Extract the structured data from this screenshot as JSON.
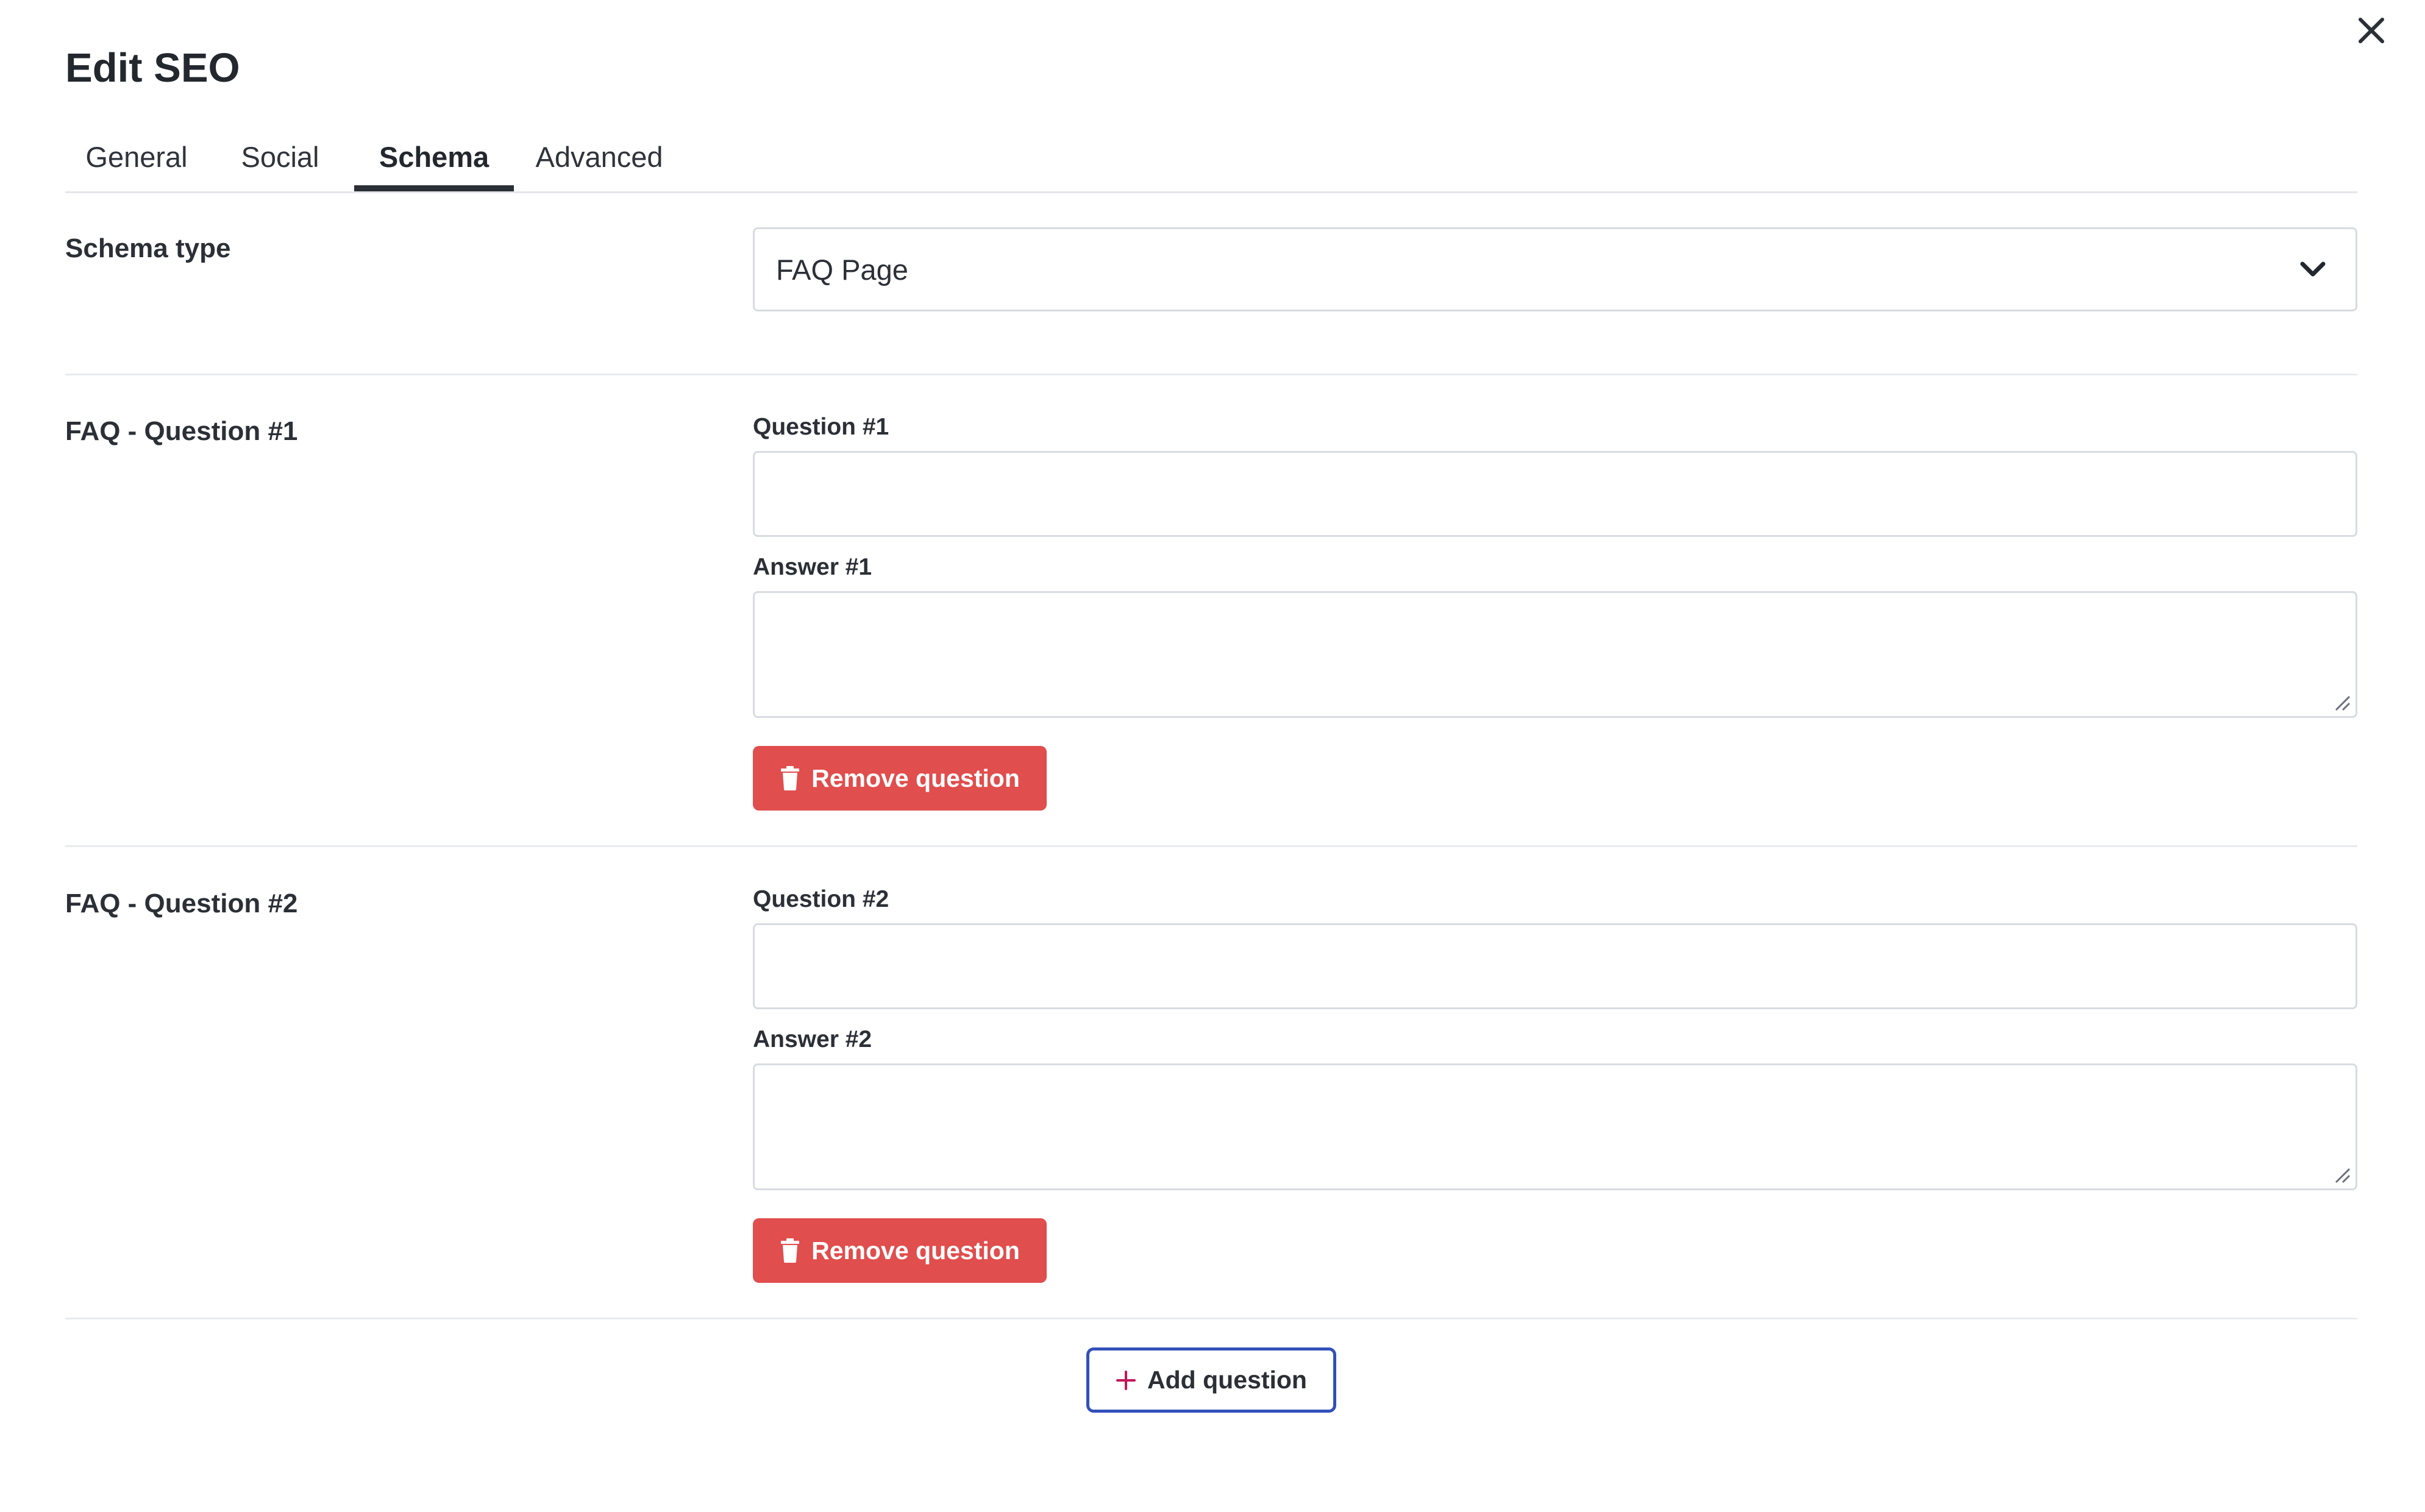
{
  "modal": {
    "title": "Edit SEO",
    "close_icon": "close-icon"
  },
  "tabs": [
    {
      "label": "General",
      "active": false
    },
    {
      "label": "Social",
      "active": false
    },
    {
      "label": "Schema",
      "active": true
    },
    {
      "label": "Advanced",
      "active": false
    }
  ],
  "schema": {
    "label": "Schema type",
    "selected": "FAQ Page",
    "dropdown_icon": "chevron-down-icon"
  },
  "faq": [
    {
      "section_label": "FAQ - Question #1",
      "question_label": "Question #1",
      "question_value": "",
      "answer_label": "Answer #1",
      "answer_value": "",
      "remove_label": "Remove question"
    },
    {
      "section_label": "FAQ - Question #2",
      "question_label": "Question #2",
      "question_value": "",
      "answer_label": "Answer #2",
      "answer_value": "",
      "remove_label": "Remove question"
    }
  ],
  "add_question_label": "Add question",
  "colors": {
    "danger": "#e04e4d",
    "primary_border": "#3350b9",
    "plus_icon": "#c2185b",
    "text": "#2b2f36"
  }
}
